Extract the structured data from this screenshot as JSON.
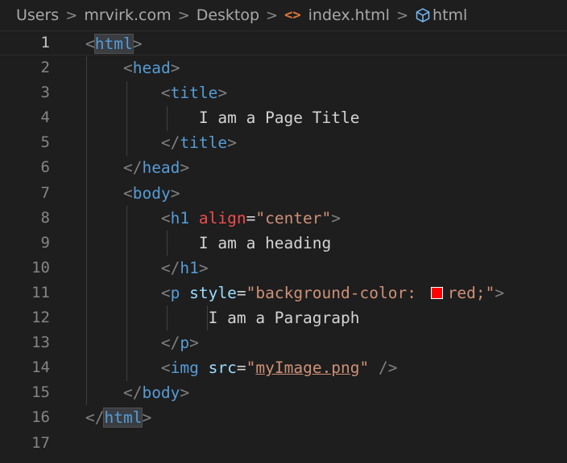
{
  "breadcrumb": {
    "items": [
      "Users",
      "mrvirk.com",
      "Desktop",
      "index.html",
      "html"
    ],
    "separator": ">",
    "file_icon": "html-file-icon",
    "symbol_icon": "cube-symbol-icon",
    "file_icon_color": "#e37933"
  },
  "editor": {
    "active_line": "1",
    "line_numbers": [
      "1",
      "2",
      "3",
      "4",
      "5",
      "6",
      "7",
      "8",
      "9",
      "10",
      "11",
      "12",
      "13",
      "14",
      "15",
      "16",
      "17"
    ],
    "tokens": {
      "html": "html",
      "head": "head",
      "title": "title",
      "body": "body",
      "h1": "h1",
      "p": "p",
      "img": "img",
      "align": "align",
      "style": "style",
      "src": "src",
      "align_value": "\"center\"",
      "style_value_start": "\"background-color: ",
      "style_value_end": "red;\"",
      "src_quote": "\"",
      "src_value": "myImage.png",
      "title_text": "I am a Page Title",
      "heading_text": "I am a heading",
      "paragraph_text": "I am a Paragraph"
    },
    "colors": {
      "background": "#1e1e1e",
      "tag": "#569cd6",
      "attribute": "#9cdcfe",
      "attribute_red": "#f14c4c",
      "string": "#ce9178",
      "text": "#d4d4d4",
      "punctuation": "#808080",
      "swatch": "#ff0000"
    }
  }
}
